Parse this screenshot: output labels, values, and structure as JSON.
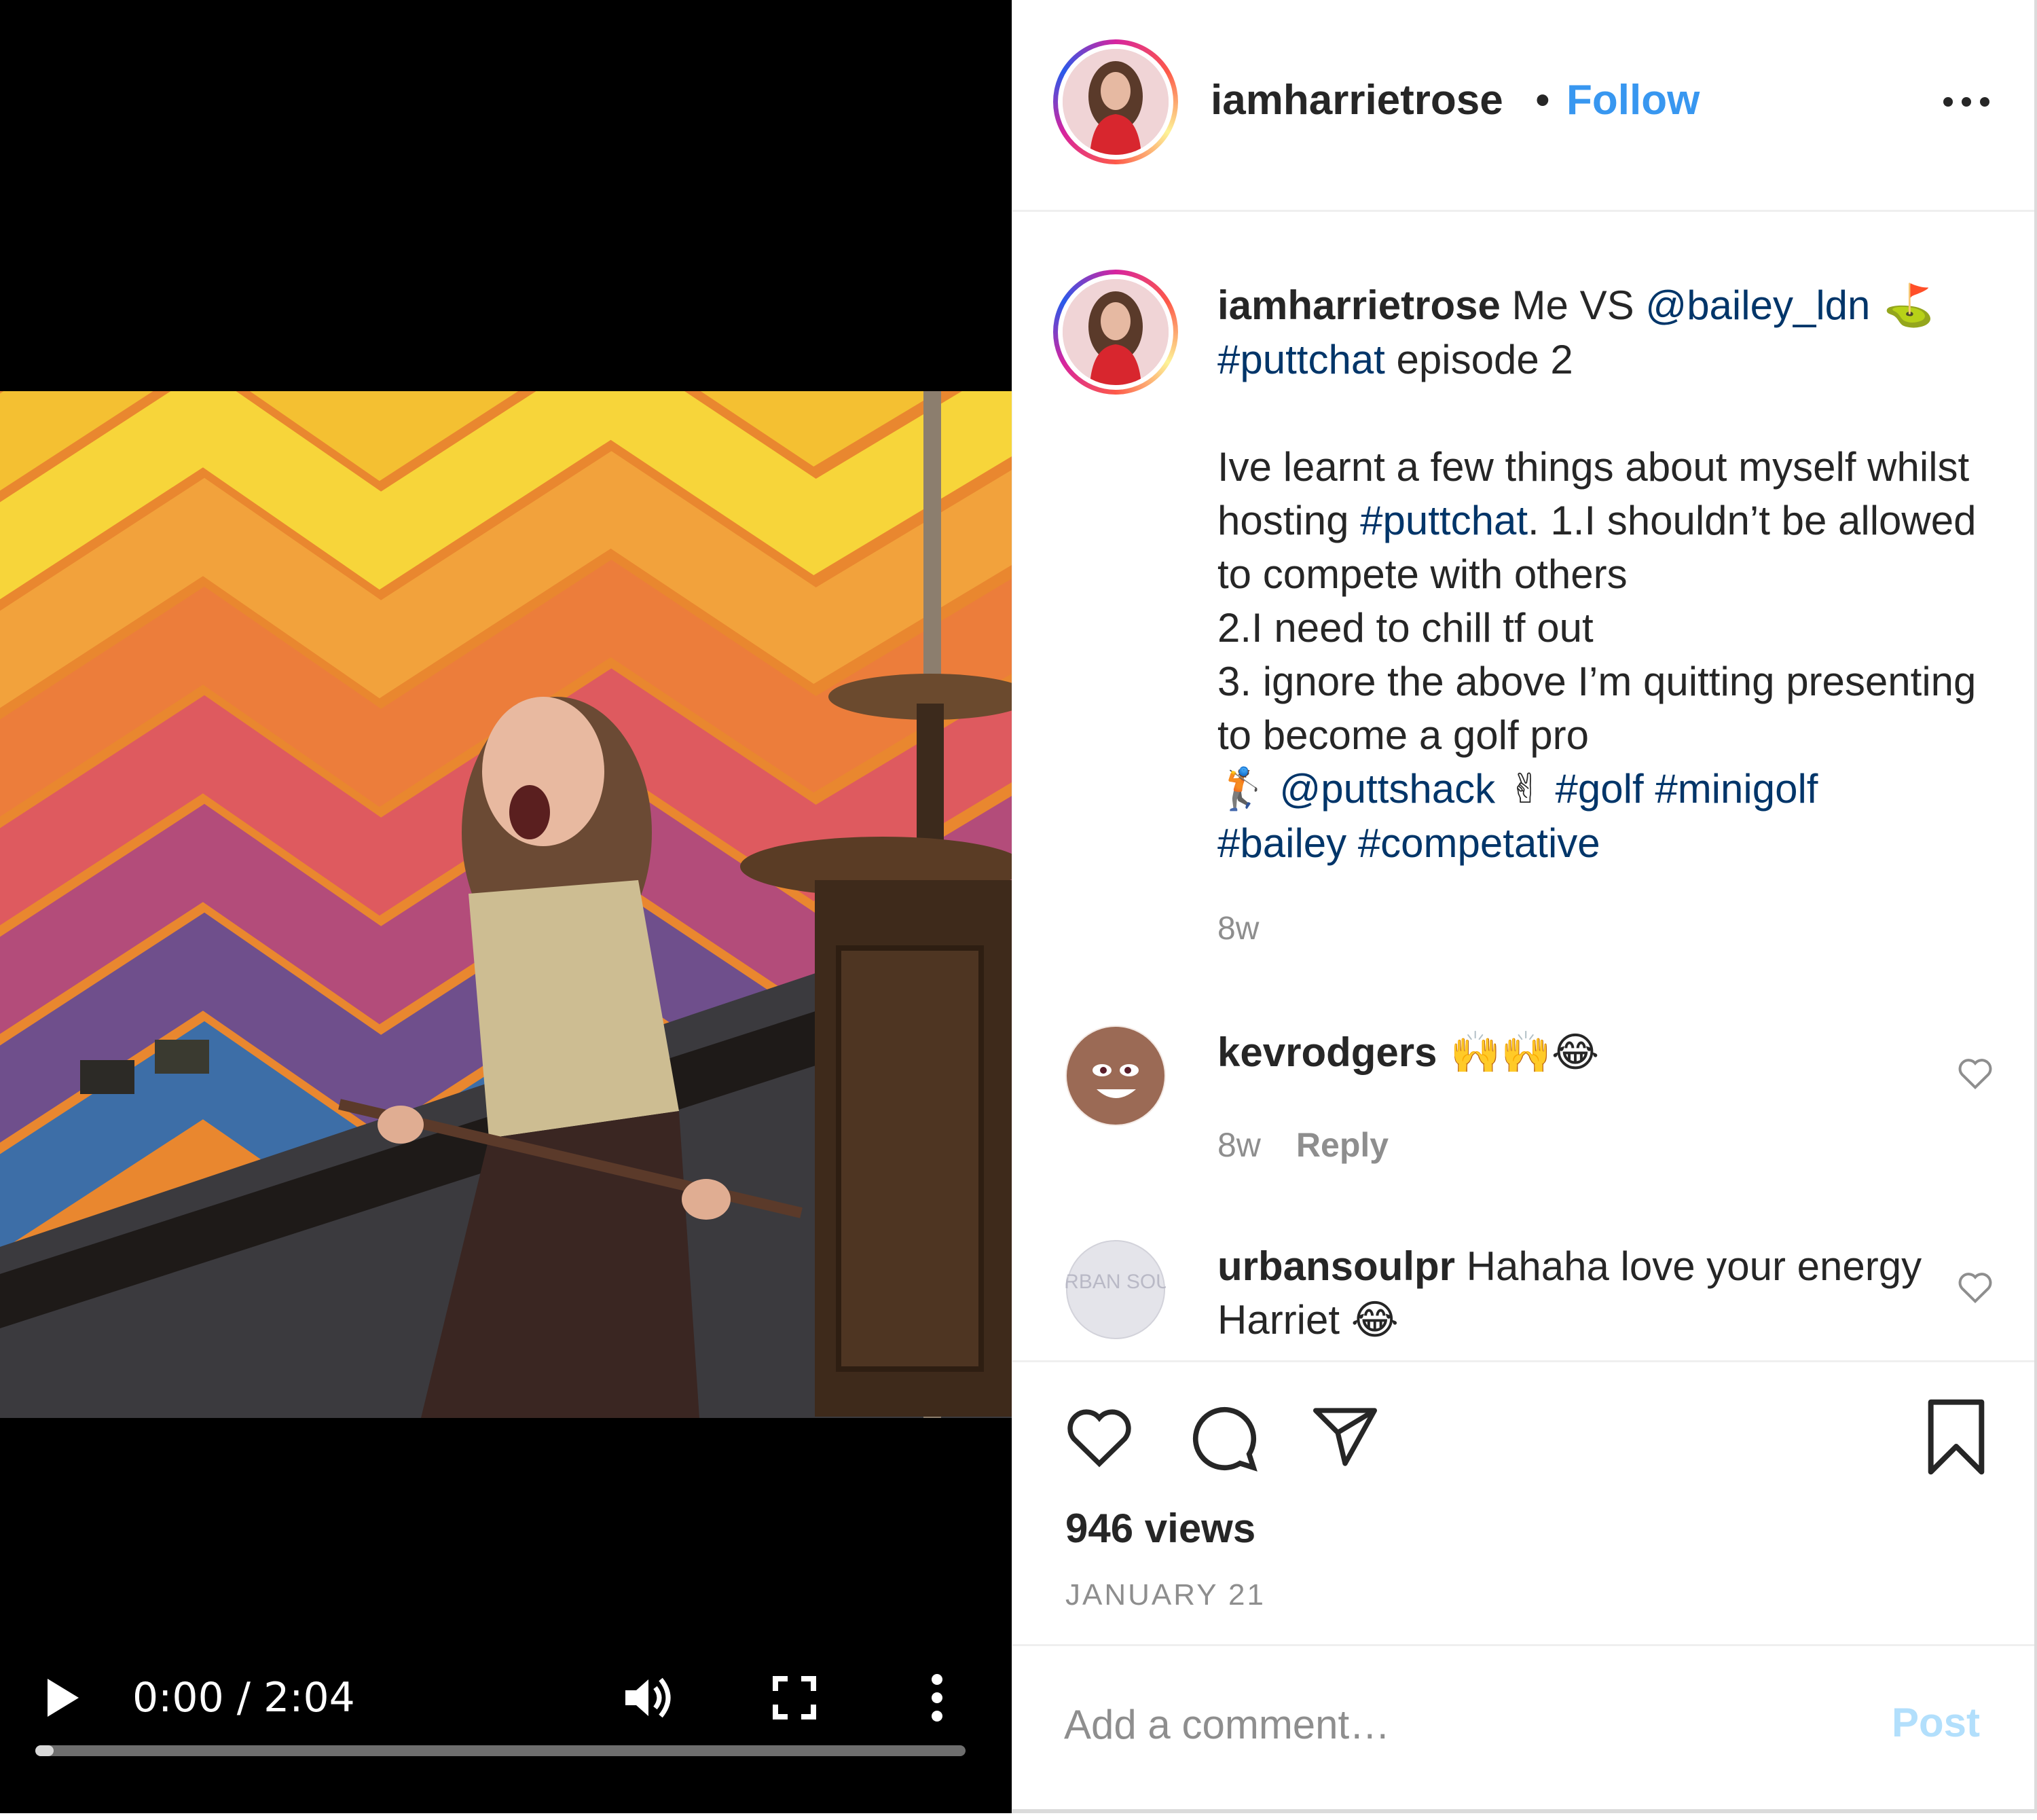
{
  "video": {
    "time": "0:00 / 2:04",
    "progress": 0.02
  },
  "post": {
    "username": "iamharrietrose",
    "separator": "•",
    "follow_label": "Follow",
    "caption": {
      "username": "iamharrietrose",
      "t1": " Me VS ",
      "mention1": "@bailey_ldn",
      "emoji1": " ⛳",
      "br1": "\n",
      "tag1": "#puttchat",
      "t2": " episode 2\n\nIve learnt a few things about myself whilst hosting ",
      "tag2": "#puttchat",
      "t3": ". 1.I shouldn’t be allowed to compete with others\n2.I need to chill tf out\n3. ignore the above I’m quitting presenting to become a golf pro\n",
      "emoji2": "🏌",
      "sp1": " ",
      "mention2": "@puttshack",
      "emoji3": " ✌ ",
      "tag3": "#golf",
      "sp2": " ",
      "tag4": "#minigolf",
      "br2": "\n",
      "tag5": "#bailey",
      "sp3": " ",
      "tag6": "#competative",
      "time": "8w"
    },
    "comments": [
      {
        "username": "kevrodgers",
        "text": " 🙌🙌😂",
        "time": "8w",
        "reply_label": "Reply"
      },
      {
        "username": "urbansoulpr",
        "text": " Hahaha love your energy Harriet 😂",
        "avatar_text": "URBAN SOUL"
      }
    ],
    "views": "946 views",
    "date": "JANUARY 21",
    "add_comment_placeholder": "Add a comment…",
    "post_label": "Post"
  },
  "colors": {
    "link": "#003569",
    "follow": "#3897f0",
    "muted": "#8e8e8e",
    "post_disabled": "#b2dffc"
  },
  "icons": {
    "header_more": "more-horizontal-icon",
    "like": "heart-icon",
    "comment": "comment-bubble-icon",
    "share": "paper-plane-icon",
    "save": "bookmark-icon",
    "play": "play-icon",
    "volume": "volume-icon",
    "fullscreen": "fullscreen-icon",
    "video_more": "more-vertical-icon"
  }
}
